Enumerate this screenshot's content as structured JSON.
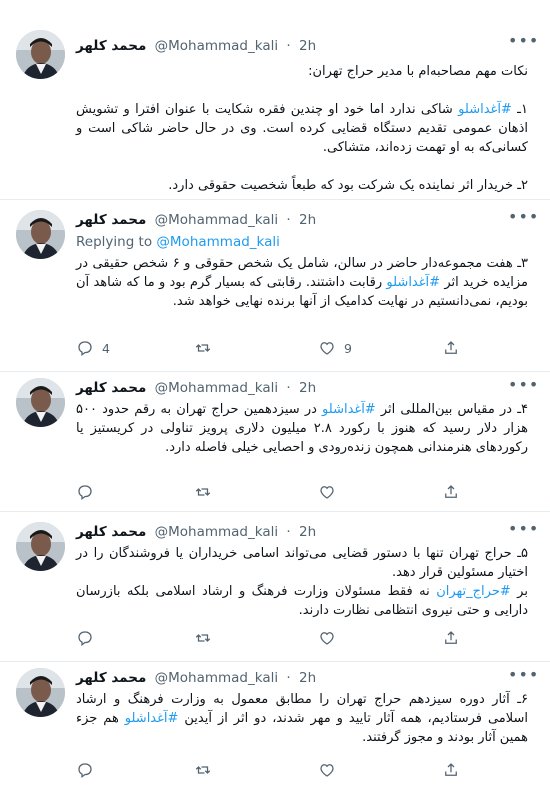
{
  "author": {
    "name": "محمد کلهر",
    "handle": "@Mohammad_kali",
    "separator": "·",
    "time": "2h"
  },
  "tweets": [
    {
      "lines": [
        "نکات مهم مصاحبه‌ام با مدیر حراج تهران:",
        "",
        "۱ـ #آغداشلو شاکی ندارد اما خود او چندین فقره شکایت با عنوان افترا و تشویش اذهان عمومی تقدیم دستگاه قضایی کرده است. وی در حال حاضر شاکی است و کسانی‌که به او تهمت زده‌اند، متشاکی.",
        "",
        "۲ـ خریدار اثر نماینده یک شرکت بود که طبعاً شخصیت حقوقی دارد."
      ]
    },
    {
      "replying_label": "Replying to",
      "replying_handle": "@Mohammad_kali",
      "text": "۳ـ هفت مجموعه‌دار حاضر در سالن، شامل یک شخص حقوقی و ۶ شخص حقیقی در مزایده خرید اثر #آغداشلو رقابت داشتند. رقابتی که بسیار گرم بود و ما که شاهد آن بودیم، نمی‌دانستیم در نهایت کدامیک از آنها برنده نهایی خواهد شد.",
      "reply_count": "4",
      "like_count": "9"
    },
    {
      "text": "۴ـ در مقیاس بین‌المللی اثر #آغداشلو در سیزدهمین حراج تهران به رقم حدود ۵۰۰ هزار دلار رسید که هنوز با رکورد ۲.۸ میلیون دلاری پرویز تناولی در کریستیز یا رکوردهای هنرمندانی همچون زنده‌رودی و احصایی خیلی فاصله دارد.",
      "reply_count": "",
      "like_count": ""
    },
    {
      "text": "۵ـ حراج تهران تنها با دستور قضایی می‌تواند اسامی خریداران یا فروشندگان را در اختیار مسئولین قرار دهد.",
      "text2": "بر #حراج_تهران نه فقط مسئولان وزارت فرهنگ و ارشاد اسلامی بلکه بازرسان دارایی و حتی نیروی انتظامی نظارت دارند.",
      "reply_count": "",
      "like_count": ""
    },
    {
      "text": "۶ـ آثار دوره سیزدهم حراج تهران را مطابق معمول به وزارت فرهنگ و ارشاد اسلامی فرستادیم، همه آثار تایید و مهر شدند، دو اثر از آیدین #آغداشلو هم جزء همین آثار بودند و مجوز گرفتند.",
      "reply_count": "",
      "like_count": ""
    }
  ],
  "more_icon": "more-dots-icon",
  "colors": {
    "link": "#1d9bf0",
    "muted": "#536471",
    "divider": "#e6ecf0"
  }
}
